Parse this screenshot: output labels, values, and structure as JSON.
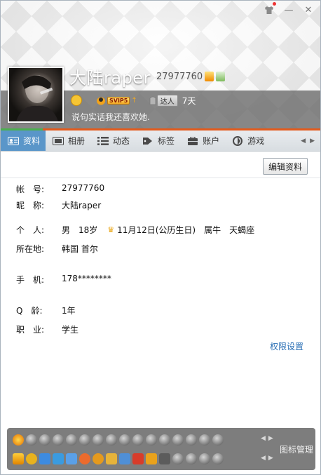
{
  "header": {
    "nickname": "大陆raper",
    "qq_number": "27977760",
    "svip_badge": "SVIP5",
    "daren_badge": "达人",
    "days": "7天",
    "signature": "说句实话我还喜欢她.",
    "title_icons": [
      "shirt-icon",
      "minimize-icon",
      "close-icon"
    ],
    "minimize_symbol": "—",
    "close_symbol": "✕"
  },
  "tabs": [
    {
      "label": "资料",
      "icon": "profile-card-icon",
      "active": true
    },
    {
      "label": "相册",
      "icon": "photo-album-icon",
      "active": false
    },
    {
      "label": "动态",
      "icon": "feed-list-icon",
      "active": false
    },
    {
      "label": "标签",
      "icon": "tag-icon",
      "active": false
    },
    {
      "label": "账户",
      "icon": "wallet-icon",
      "active": false
    },
    {
      "label": "游戏",
      "icon": "game-icon",
      "active": false
    }
  ],
  "profile": {
    "edit_button": "编辑资料",
    "account_label": "帐　号:",
    "account_value": "27977760",
    "nick_label": "昵　称:",
    "nick_value": "大陆raper",
    "person_label": "个　人:",
    "gender": "男",
    "age": "18岁",
    "birthday": "11月12日(公历生日)",
    "zodiac": "属牛",
    "constellation": "天蝎座",
    "location_label": "所在地:",
    "location_value": "韩国 首尔",
    "phone_label": "手　机:",
    "phone_value": "178********",
    "qage_label": "Q　龄:",
    "qage_value": "1年",
    "job_label": "职　业:",
    "job_value": "学生",
    "permission_link": "权限设置"
  },
  "icon_panel": {
    "manage_label": "图标管理"
  },
  "colors": {
    "tab_active": "#5a96c9",
    "link": "#2a6fb5",
    "panel_bg": "#7d7d7d"
  }
}
